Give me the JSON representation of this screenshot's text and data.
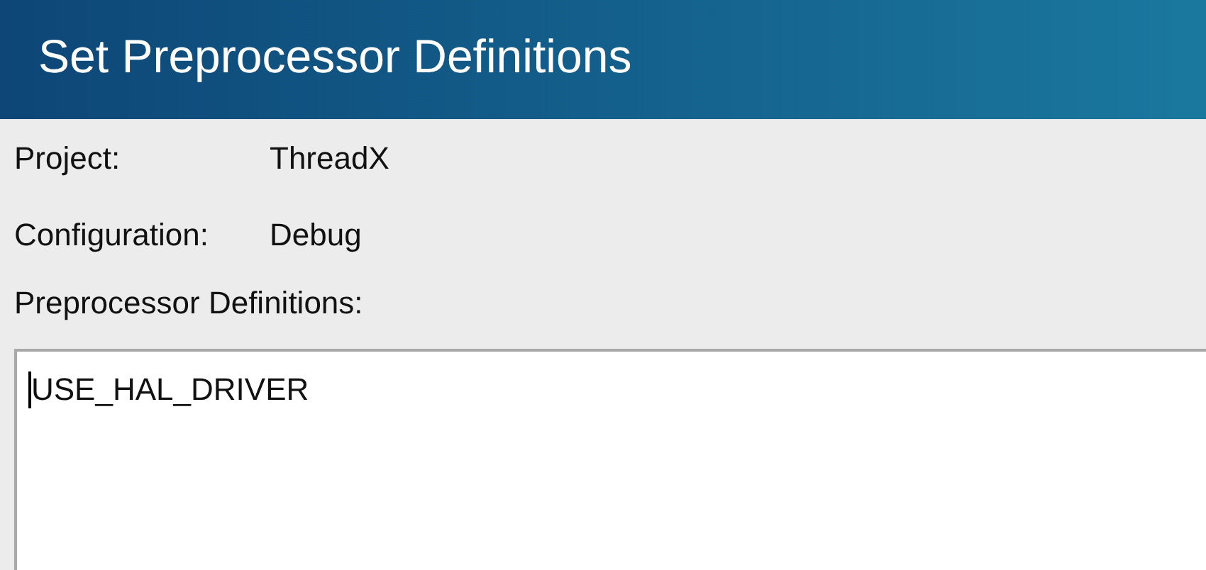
{
  "window": {
    "title": "Set Preprocessor Definitions"
  },
  "fields": [
    {
      "label": "Project:",
      "value": "ThreadX"
    },
    {
      "label": "Configuration:",
      "value": "Debug"
    }
  ],
  "definitions": {
    "label": "Preprocessor Definitions:",
    "value": "USE_HAL_DRIVER"
  }
}
